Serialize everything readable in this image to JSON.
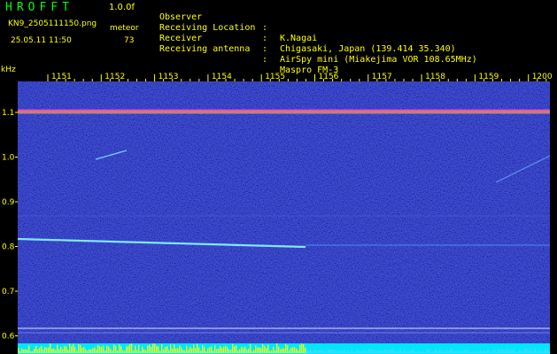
{
  "header": {
    "app_title": "HROFFT",
    "version": "1.0.0f",
    "filename": "KN9_2505111150.png",
    "mode": "meteor",
    "datetime": "25.05.11 11:50",
    "count": "73"
  },
  "info": [
    {
      "key": "Observer",
      "value": "K.Nagai"
    },
    {
      "key": "Receiving Location",
      "value": "Chigasaki, Japan (139.414 35.340)"
    },
    {
      "key": "Receiver",
      "value": "AirSpy mini (Miakejima VOR 108.65MHz)"
    },
    {
      "key": "Receiving antenna",
      "value": "Maspro FM-3"
    }
  ],
  "chart_data": {
    "type": "spectrogram",
    "frequency_unit": "kHz",
    "time_ticks": [
      "1151",
      "1152",
      "1153",
      "1154",
      "1155",
      "1156",
      "1157",
      "1158",
      "1159",
      "1200"
    ],
    "frequency_ticks": [
      "1.1",
      "1.0",
      "0.9",
      "0.8",
      "0.7",
      "0.6"
    ],
    "frequency_range": [
      0.6,
      1.16
    ],
    "colors": {
      "background": "#000000",
      "spectrum": "#1a1f7a",
      "text": "#ffff00",
      "signal": "#7fe6ff",
      "carrier": "#ff7070",
      "power_bar": "#00e6ff",
      "power_peak": "#ffff00"
    }
  }
}
